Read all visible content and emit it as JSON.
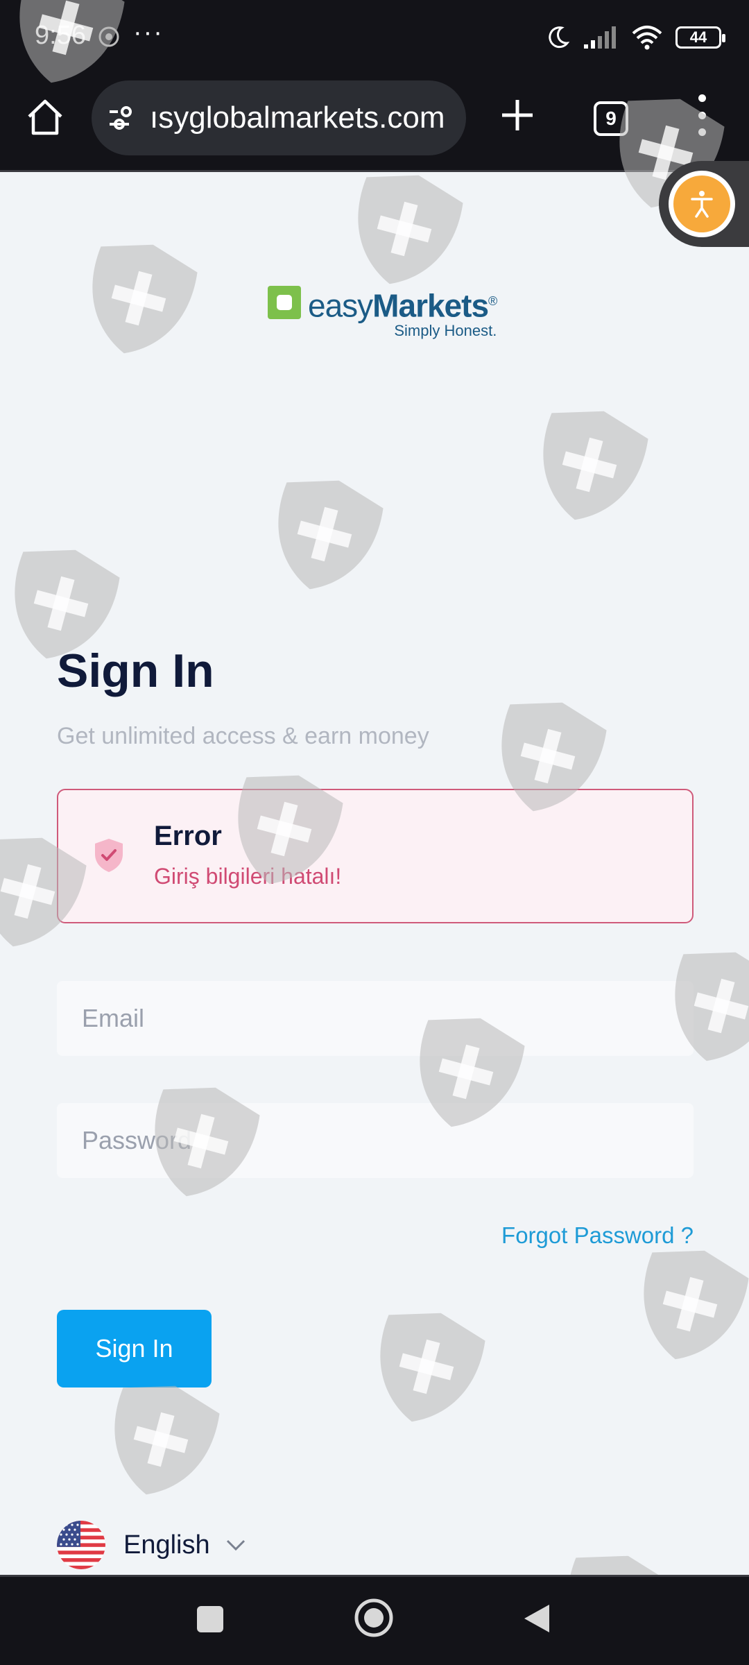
{
  "status_bar": {
    "time": "9:56",
    "dots": "···",
    "battery": "44"
  },
  "browser": {
    "url": "ısyglobalmarkets.com",
    "tab_count": "9"
  },
  "logo": {
    "name_light": "easy",
    "name_bold": "Markets",
    "registered": "®",
    "tagline": "Simply Honest."
  },
  "page": {
    "title": "Sign In",
    "subtitle": "Get unlimited access & earn money"
  },
  "error": {
    "title": "Error",
    "message": "Giriş bilgileri hatalı!"
  },
  "form": {
    "email_placeholder": "Email",
    "password_placeholder": "Password",
    "forgot_label": "Forgot Password ?",
    "submit_label": "Sign In"
  },
  "language": {
    "selected": "English"
  },
  "colors": {
    "primary": "#0aa2f0",
    "error_border": "#cf5a7a",
    "error_text": "#d04a73",
    "link": "#1e9bd6",
    "title": "#101a3a",
    "logo": "#1b5b86",
    "logo_mark": "#7dc04b",
    "accessibility": "#f7a93b"
  },
  "icons": {
    "home": "home-icon",
    "site_settings": "tune-icon",
    "new_tab": "plus-icon",
    "tab_switcher": "tab-count-icon",
    "overflow": "more-vert-icon",
    "accessibility": "accessibility-icon",
    "error": "shield-check-icon",
    "language_flag": "us-flag-icon",
    "dropdown": "chevron-down-icon",
    "watermark": "shield-plus-icon"
  }
}
